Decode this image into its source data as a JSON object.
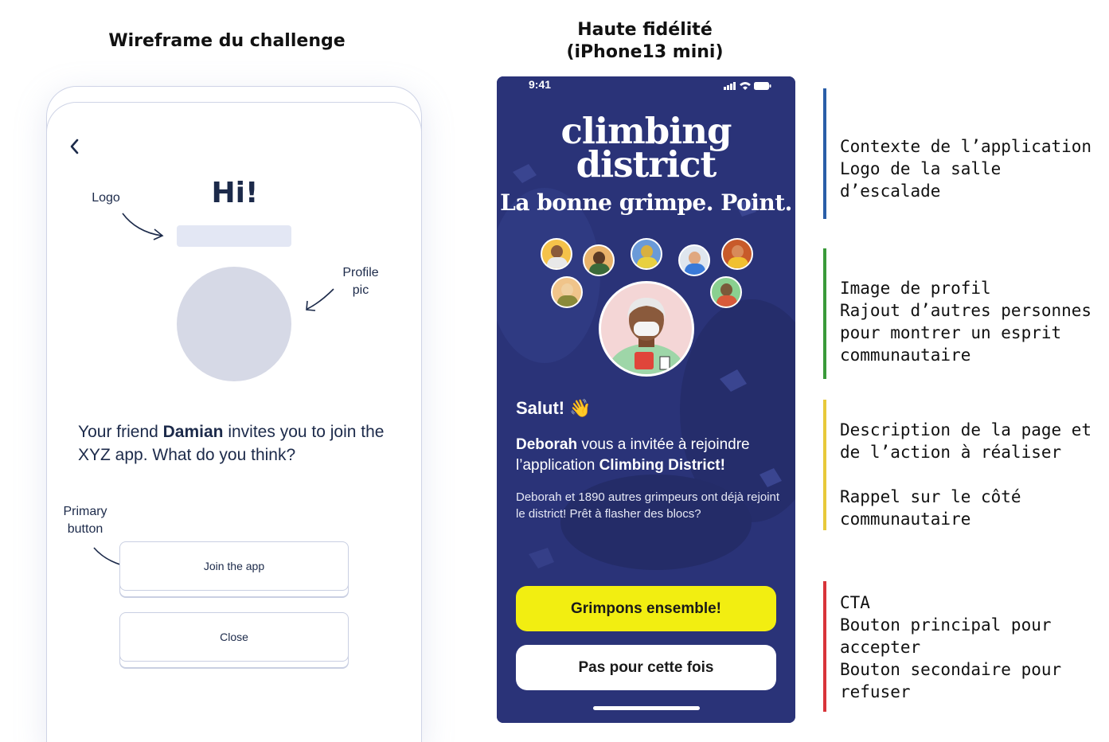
{
  "titles": {
    "wireframe": "Wireframe du challenge",
    "hifi_line1": "Haute fidélité",
    "hifi_line2": "(iPhone13 mini)"
  },
  "wireframe": {
    "greeting": "Hi!",
    "note_logo": "Logo",
    "note_profile_line1": "Profile",
    "note_profile_line2": "pic",
    "note_primary_line1": "Primary",
    "note_primary_line2": "button",
    "text_part1": "Your friend ",
    "text_name": "Damian",
    "text_part2": " invites you to join the XYZ app. What do you think?",
    "primary_button": "Join the app",
    "secondary_button": "Close",
    "back_icon": "chevron-left-icon"
  },
  "phone": {
    "status_time": "9:41",
    "brand_line1": "climbing",
    "brand_line2": "district",
    "tagline": "La bonne grimpe. Point.",
    "greeting": "Salut! 👋",
    "invite_name": "Deborah",
    "invite_part1": " vous a invitée à rejoindre l’application ",
    "invite_app": "Climbing District!",
    "invite_sub": "Deborah et 1890 autres grimpeurs ont déjà rejoint le district! Prêt à flasher des blocs?",
    "primary_button": "Grimpons ensemble!",
    "secondary_button": "Pas pour cette fois",
    "colors": {
      "background": "#2a3378",
      "primary_button": "#f2ee11",
      "secondary_button": "#ffffff"
    }
  },
  "annotations": [
    {
      "text": "Contexte de l’application\nLogo de la salle d’escalade",
      "color": "#2a5ea8"
    },
    {
      "text": "Image de profil\nRajout d’autres personnes pour montrer un esprit communautaire",
      "color": "#3a9a3a"
    },
    {
      "text": "Description de la page et de l’action à réaliser\n\nRappel sur le côté communautaire",
      "color": "#e8c93a"
    },
    {
      "text": "CTA\nBouton principal pour accepter\nBouton secondaire pour refuser",
      "color": "#d8343a"
    }
  ]
}
